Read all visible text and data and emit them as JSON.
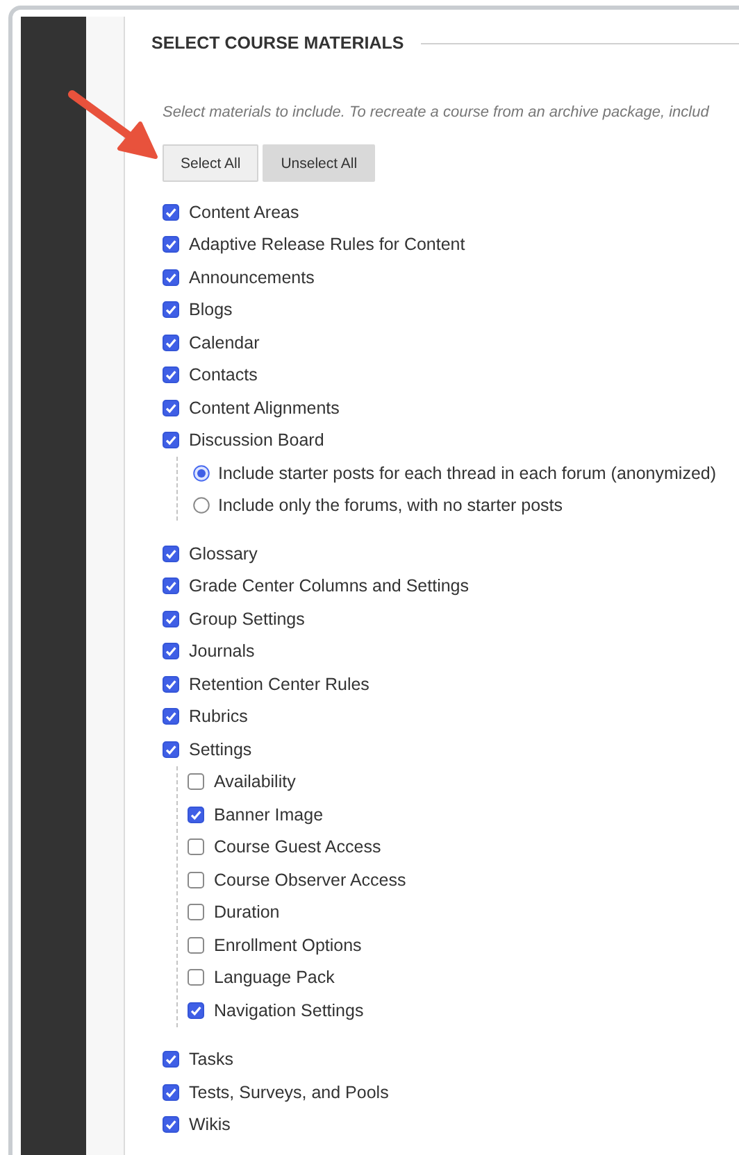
{
  "section": {
    "title": "SELECT COURSE MATERIALS",
    "instructions": "Select materials to include. To recreate a course from an archive package, includ"
  },
  "buttons": [
    {
      "label": "Select All",
      "kind": "light"
    },
    {
      "label": "Unselect All",
      "kind": "dark"
    }
  ],
  "materials": [
    {
      "label": "Content Areas",
      "checked": true
    },
    {
      "label": "Adaptive Release Rules for Content",
      "checked": true
    },
    {
      "label": "Announcements",
      "checked": true
    },
    {
      "label": "Blogs",
      "checked": true
    },
    {
      "label": "Calendar",
      "checked": true
    },
    {
      "label": "Contacts",
      "checked": true
    },
    {
      "label": "Content Alignments",
      "checked": true
    },
    {
      "label": "Discussion Board",
      "checked": true,
      "options": [
        {
          "label": "Include starter posts for each thread in each forum (anonymized)",
          "selected": true
        },
        {
          "label": "Include only the forums, with no starter posts",
          "selected": false
        }
      ]
    },
    {
      "label": "Glossary",
      "checked": true
    },
    {
      "label": "Grade Center Columns and Settings",
      "checked": true
    },
    {
      "label": "Group Settings",
      "checked": true
    },
    {
      "label": "Journals",
      "checked": true
    },
    {
      "label": "Retention Center Rules",
      "checked": true
    },
    {
      "label": "Rubrics",
      "checked": true
    },
    {
      "label": "Settings",
      "checked": true,
      "children": [
        {
          "label": "Availability",
          "checked": false
        },
        {
          "label": "Banner Image",
          "checked": true
        },
        {
          "label": "Course Guest Access",
          "checked": false
        },
        {
          "label": "Course Observer Access",
          "checked": false
        },
        {
          "label": "Duration",
          "checked": false
        },
        {
          "label": "Enrollment Options",
          "checked": false
        },
        {
          "label": "Language Pack",
          "checked": false
        },
        {
          "label": "Navigation Settings",
          "checked": true
        }
      ]
    },
    {
      "label": "Tasks",
      "checked": true
    },
    {
      "label": "Tests, Surveys, and Pools",
      "checked": true
    },
    {
      "label": "Wikis",
      "checked": true
    }
  ]
}
